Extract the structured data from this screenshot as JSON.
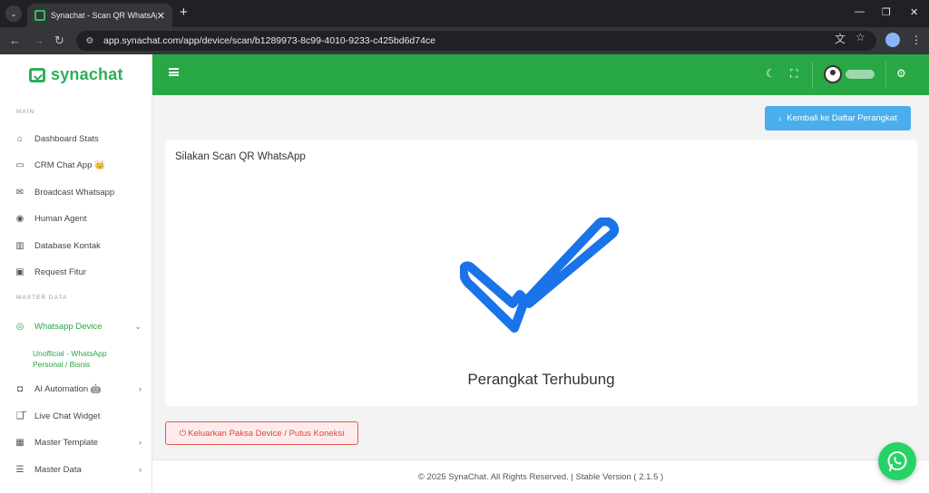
{
  "browser": {
    "tab_title": "Synachat - Scan QR WhatsApp",
    "url": "app.synachat.com/app/device/scan/b1289973-8c99-4010-9233-c425bd6d74ce"
  },
  "brand": {
    "name": "synachat",
    "color": "#2fae58"
  },
  "sidebar": {
    "section_main": "MAIN",
    "section_master": "MASTER DATA",
    "items_main": [
      {
        "label": "Dashboard Stats",
        "icon": "home-icon"
      },
      {
        "label": "CRM Chat App 👑",
        "icon": "chat-icon"
      },
      {
        "label": "Broadcast Whatsapp",
        "icon": "mail-icon"
      },
      {
        "label": "Human Agent",
        "icon": "user-circle-icon"
      },
      {
        "label": "Database Kontak",
        "icon": "book-icon"
      },
      {
        "label": "Request Fitur",
        "icon": "clipboard-icon"
      }
    ],
    "active_item": {
      "label": "Whatsapp Device",
      "icon": "whatsapp-icon"
    },
    "active_sub": "Unofficial - WhatsApp Personal / Bisnis",
    "items_master": [
      {
        "label": "AI Automation 🤖",
        "icon": "robot-icon"
      },
      {
        "label": "Live Chat Widget",
        "icon": "widget-icon"
      },
      {
        "label": "Master Template",
        "icon": "template-icon"
      },
      {
        "label": "Master Data",
        "icon": "list-icon"
      }
    ]
  },
  "header": {
    "accent": "#28a745"
  },
  "main": {
    "back_button": "Kembali ke Daftar Perangkat",
    "card_title": "Silakan Scan QR WhatsApp",
    "status": "Perangkat Terhubung",
    "logout_button": "Keluarkan Paksa Device / Putus Koneksi",
    "check_color": "#1a73e8"
  },
  "footer": {
    "text": "© 2025 SynaChat. All Rights Reserved. | Stable Version ( 2.1.5 )"
  }
}
